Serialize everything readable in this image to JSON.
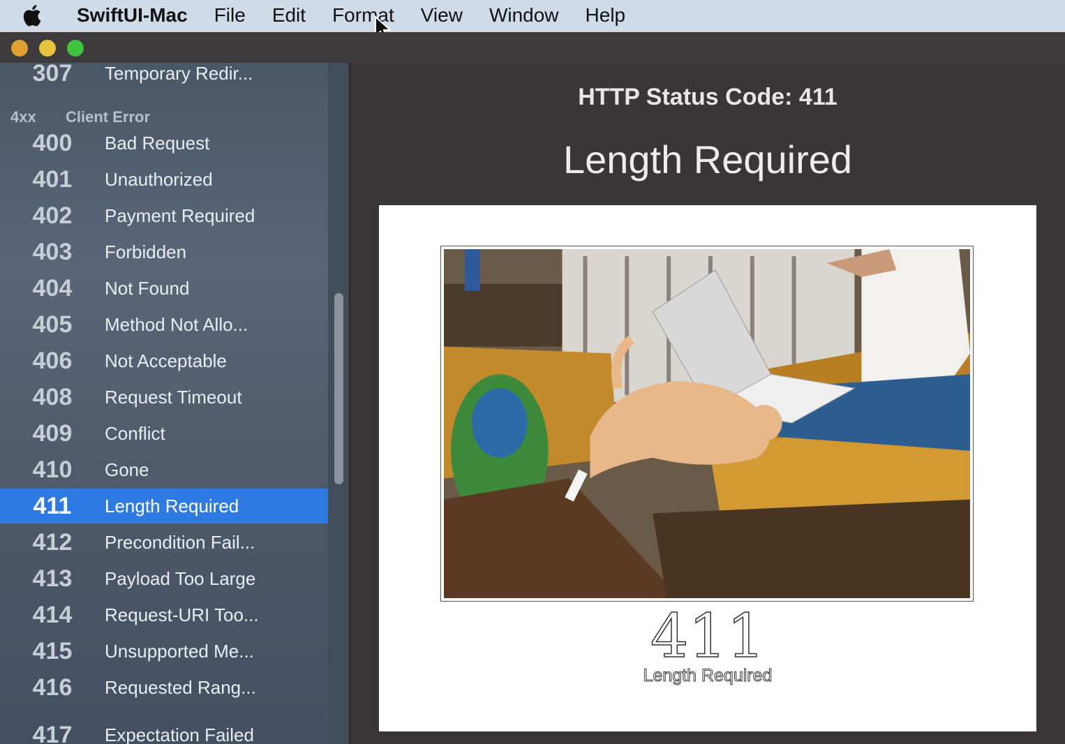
{
  "menubar": {
    "app_name": "SwiftUI-Mac",
    "items": [
      "File",
      "Edit",
      "Format",
      "View",
      "Window",
      "Help"
    ]
  },
  "sidebar": {
    "partial_top": {
      "code": "307",
      "label": "Temporary Redir..."
    },
    "section": {
      "code": "4xx",
      "label": "Client Error"
    },
    "items": [
      {
        "code": "400",
        "label": "Bad Request"
      },
      {
        "code": "401",
        "label": "Unauthorized"
      },
      {
        "code": "402",
        "label": "Payment Required"
      },
      {
        "code": "403",
        "label": "Forbidden"
      },
      {
        "code": "404",
        "label": "Not Found"
      },
      {
        "code": "405",
        "label": "Method Not Allo..."
      },
      {
        "code": "406",
        "label": "Not Acceptable"
      },
      {
        "code": "408",
        "label": "Request Timeout"
      },
      {
        "code": "409",
        "label": "Conflict"
      },
      {
        "code": "410",
        "label": "Gone"
      },
      {
        "code": "411",
        "label": "Length Required"
      },
      {
        "code": "412",
        "label": "Precondition Fail..."
      },
      {
        "code": "413",
        "label": "Payload Too Large"
      },
      {
        "code": "414",
        "label": "Request-URI Too..."
      },
      {
        "code": "415",
        "label": "Unsupported Me..."
      },
      {
        "code": "416",
        "label": "Requested Rang..."
      }
    ],
    "partial_bottom": {
      "code": "417",
      "label": "Expectation Failed"
    },
    "selected_code": "411"
  },
  "detail": {
    "title": "HTTP Status Code: 411",
    "name": "Length Required",
    "image_code": "411",
    "image_caption": "Length Required"
  },
  "colors": {
    "selection": "#2f79e3",
    "detail_bg": "#3a3536"
  }
}
